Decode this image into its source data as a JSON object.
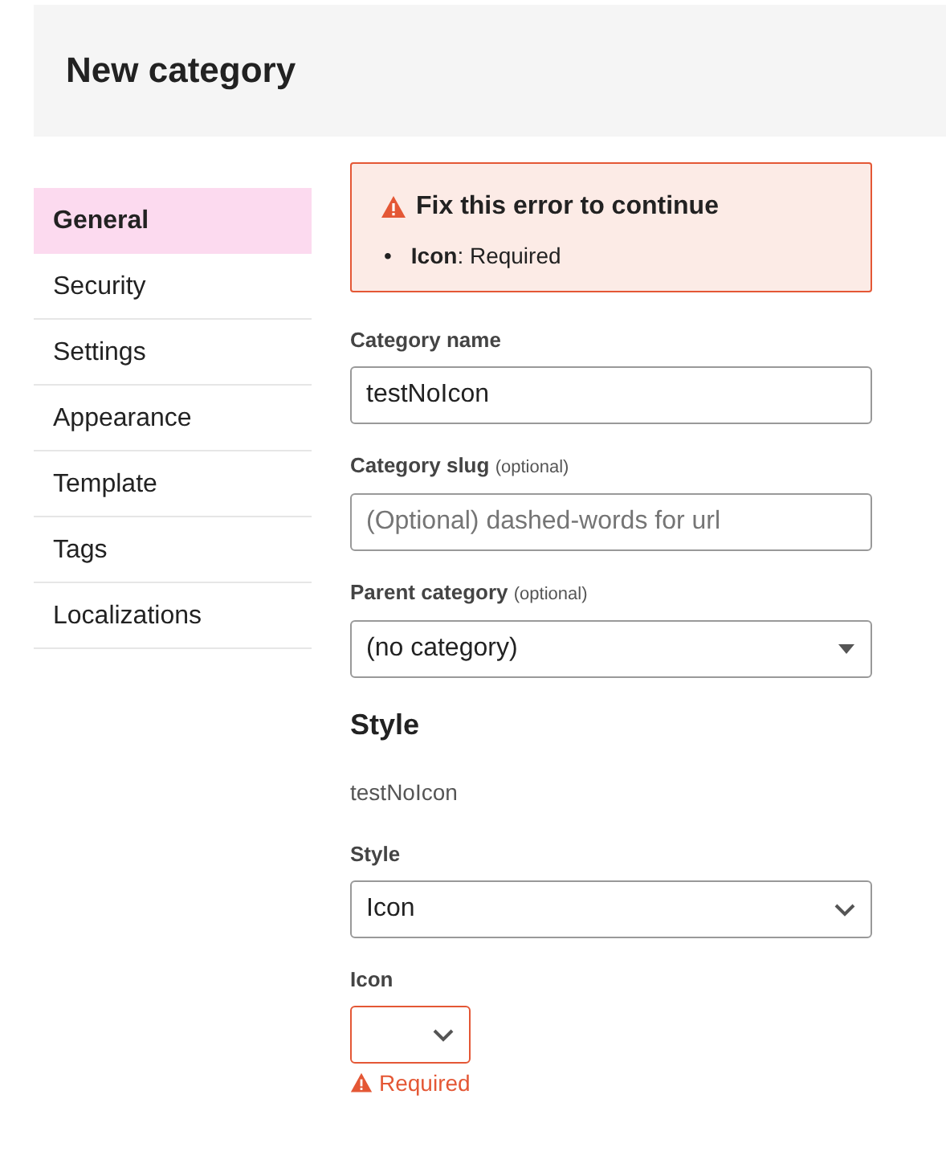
{
  "header": {
    "title": "New category"
  },
  "sidebar": {
    "items": [
      {
        "label": "General",
        "selected": true
      },
      {
        "label": "Security",
        "selected": false
      },
      {
        "label": "Settings",
        "selected": false
      },
      {
        "label": "Appearance",
        "selected": false
      },
      {
        "label": "Template",
        "selected": false
      },
      {
        "label": "Tags",
        "selected": false
      },
      {
        "label": "Localizations",
        "selected": false
      }
    ]
  },
  "error_alert": {
    "title": "Fix this error to continue",
    "items": [
      {
        "bullet": "•",
        "text": "**Icon**: Required"
      }
    ]
  },
  "fields": [
    {
      "kind": "input",
      "label": "Category name",
      "value": "testNoIcon"
    },
    {
      "kind": "input",
      "label": "Category slug",
      "hint": "(optional)",
      "placeholder": "(Optional) dashed-words for url"
    },
    {
      "kind": "combo",
      "label": "Parent category",
      "hint": "(optional)",
      "value": "(no category)"
    },
    {
      "kind": "heading",
      "label": "Style"
    },
    {
      "kind": "preview",
      "value": "testNoIcon"
    },
    {
      "kind": "select",
      "label": "Style",
      "value": "Icon"
    },
    {
      "kind": "icon-picker",
      "label": "Icon",
      "invalid": true,
      "error": "Required"
    }
  ]
}
